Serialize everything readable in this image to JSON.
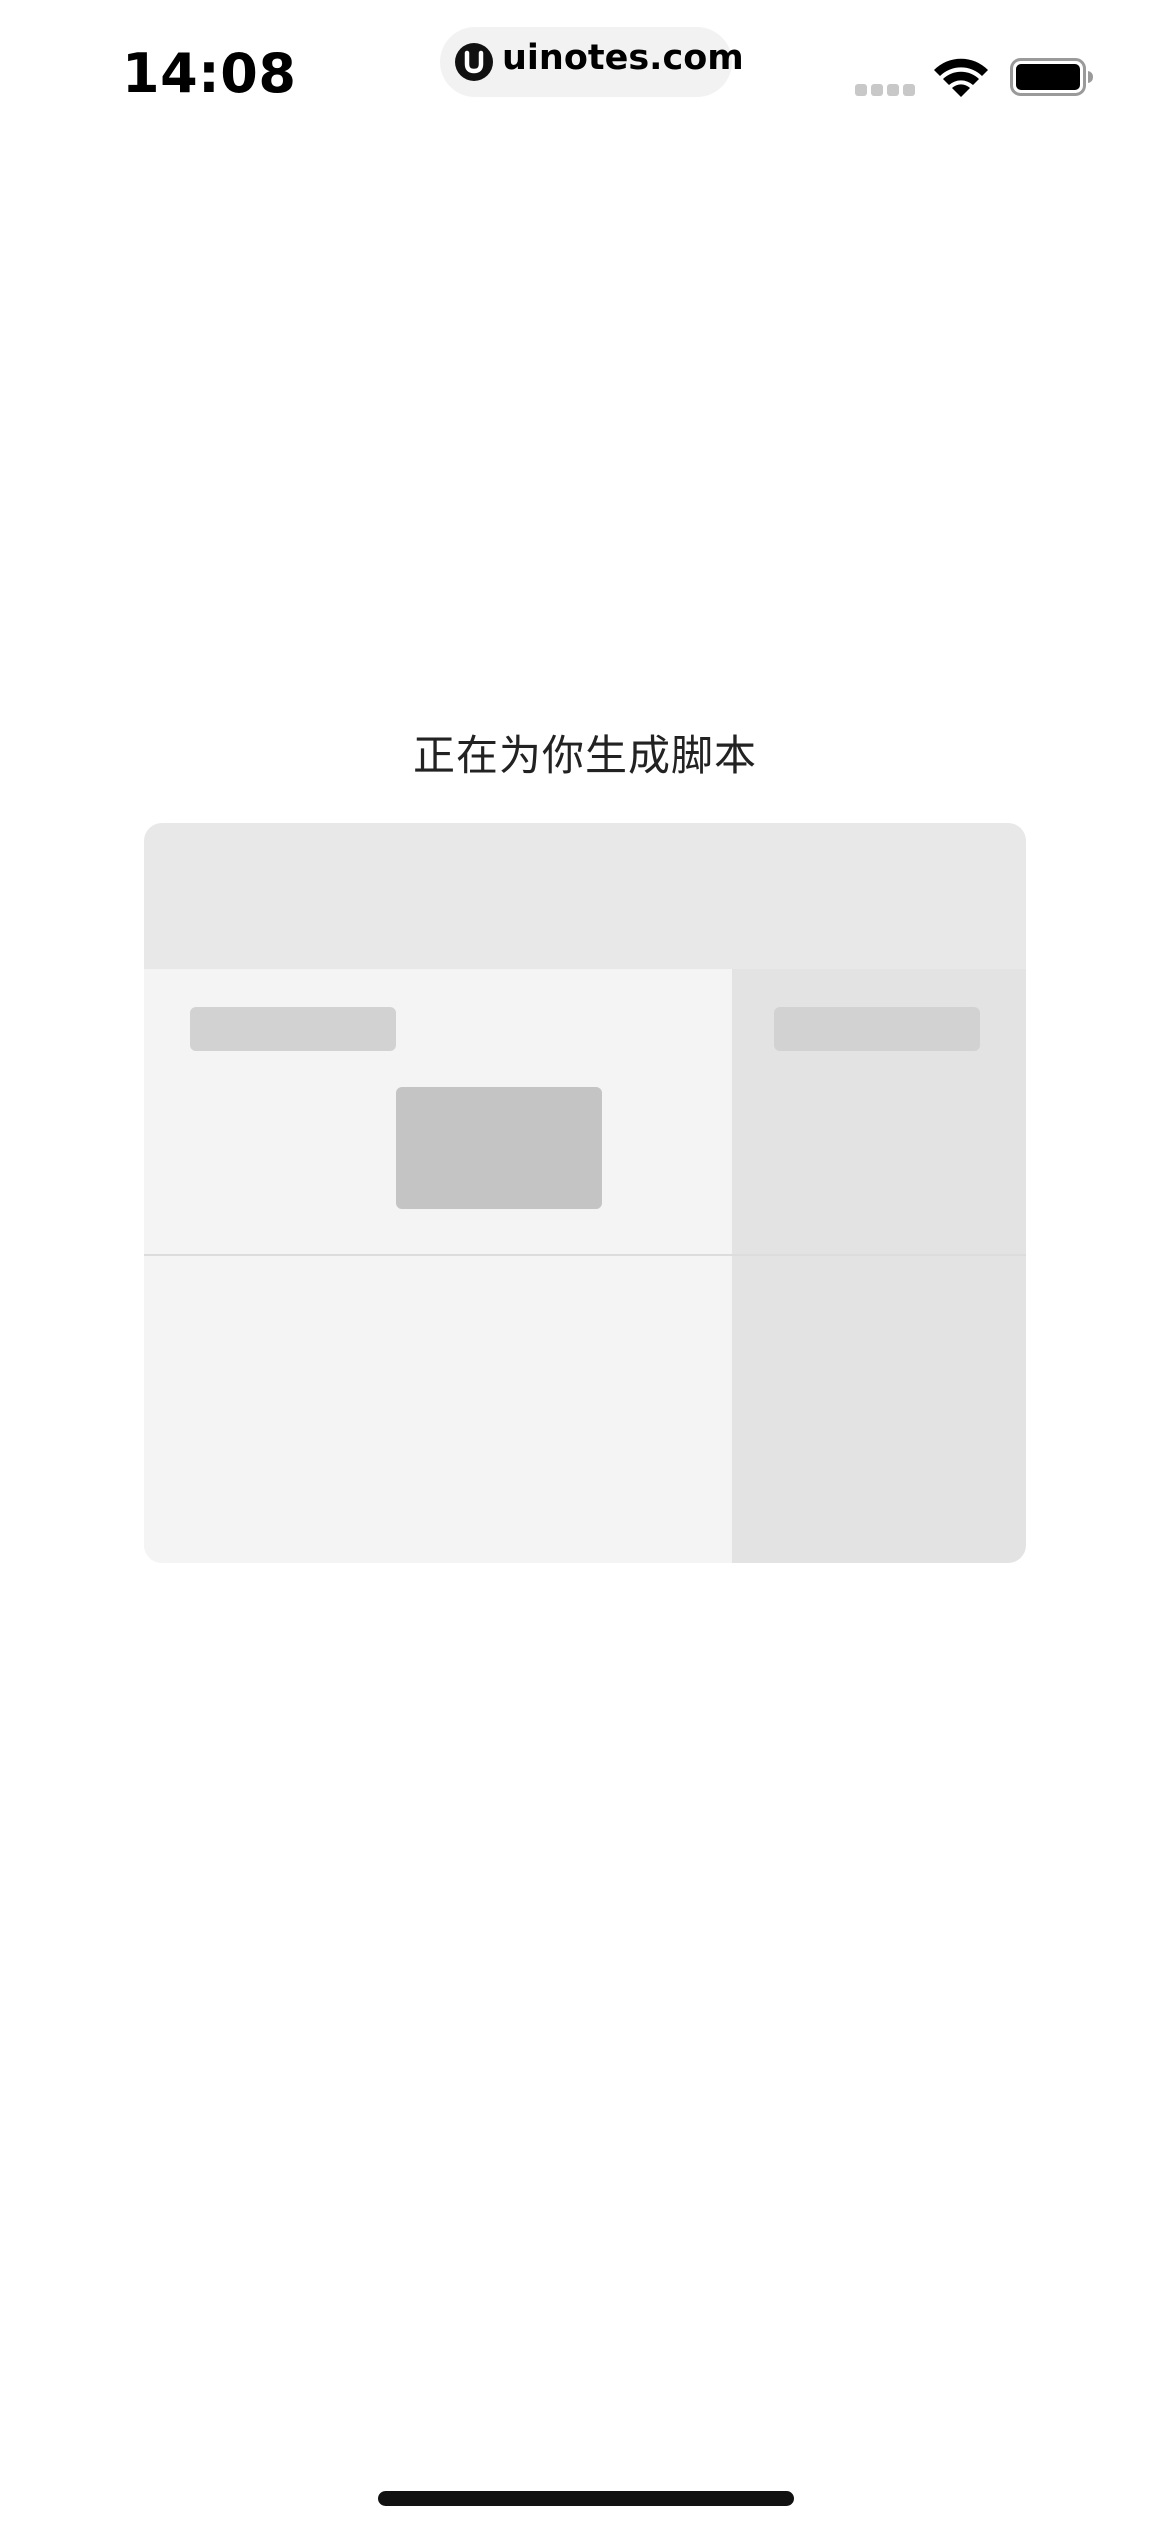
{
  "status_bar": {
    "time": "14:08",
    "url": "uinotes.com",
    "icons": [
      "signal-icon",
      "wifi-icon",
      "battery-icon"
    ]
  },
  "main": {
    "loading_title": "正在为你生成脚本"
  },
  "colors": {
    "background": "#ffffff",
    "card_header": "#e8e8e8",
    "card_body": "#f4f4f4",
    "card_side_panel": "#e3e3e3",
    "skeleton_light": "#d2d2d2",
    "skeleton_dark": "#c4c4c4",
    "text": "#222222"
  }
}
